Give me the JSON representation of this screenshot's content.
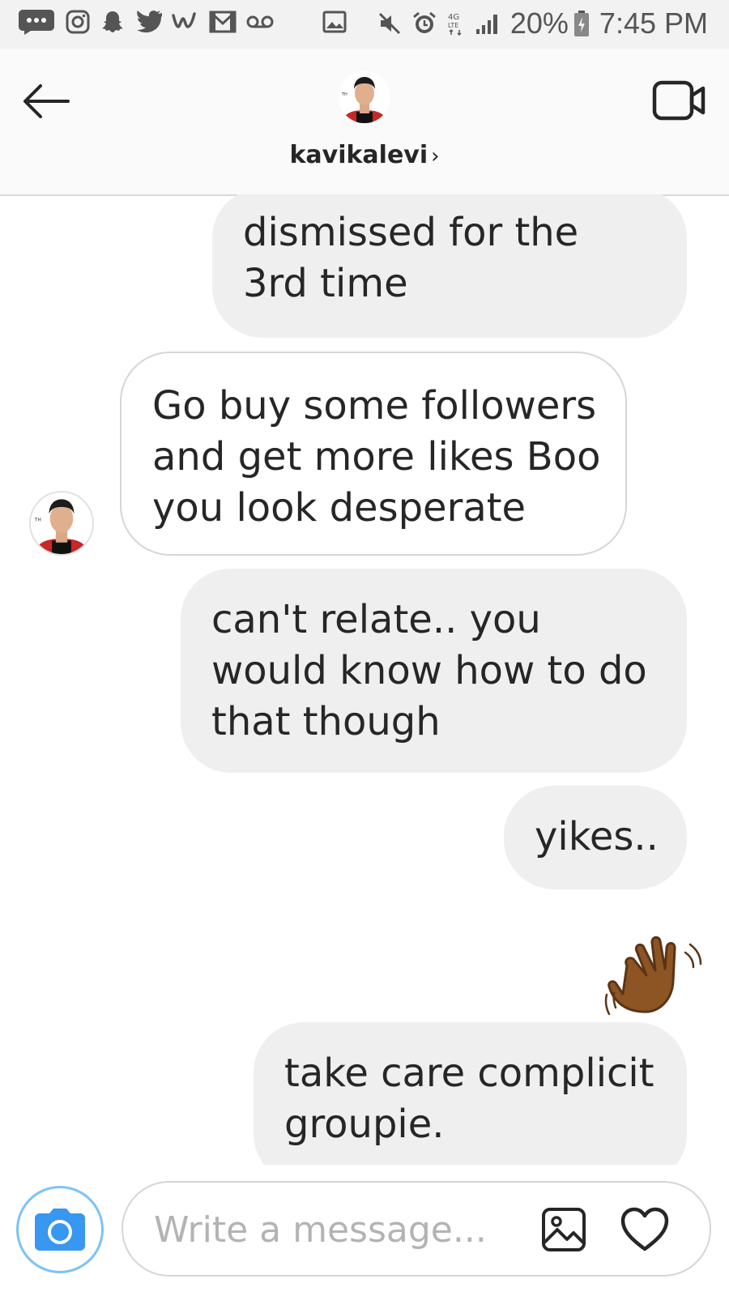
{
  "status_bar": {
    "notification_icons": [
      "more-messages-icon",
      "instagram-icon",
      "snapchat-icon",
      "twitter-icon",
      "w-app-icon",
      "gmail-icon",
      "voicemail-icon",
      "gallery-notification-icon"
    ],
    "system_icons": [
      "mute-icon",
      "alarm-icon",
      "lte-icon",
      "signal-icon"
    ],
    "battery_percent": "20%",
    "time": "7:45 PM"
  },
  "header": {
    "username": "kavikalevi",
    "chevron": "›",
    "back_icon": "back-arrow-icon",
    "video_icon": "video-call-icon"
  },
  "messages": [
    {
      "from": "me",
      "text": "dismissed for the 3rd time"
    },
    {
      "from": "them",
      "text": "Go buy some followers and get more likes Boo you look desperate"
    },
    {
      "from": "me",
      "text": "can't relate.. you would know how to do that though"
    },
    {
      "from": "me",
      "text": "yikes.."
    },
    {
      "from": "me",
      "emoji": "waving-hand-medium-dark-skin"
    },
    {
      "from": "me",
      "text": "take care complicit groupie."
    }
  ],
  "composer": {
    "placeholder": "Write a message...",
    "camera_icon": "camera-icon",
    "gallery_icon": "gallery-icon",
    "heart_icon": "heart-icon"
  },
  "colors": {
    "sent_bubble": "#efefef",
    "received_border": "#d6d6d6",
    "camera_button": "#3897f0",
    "text": "#262626",
    "placeholder": "#b3b3b3"
  }
}
